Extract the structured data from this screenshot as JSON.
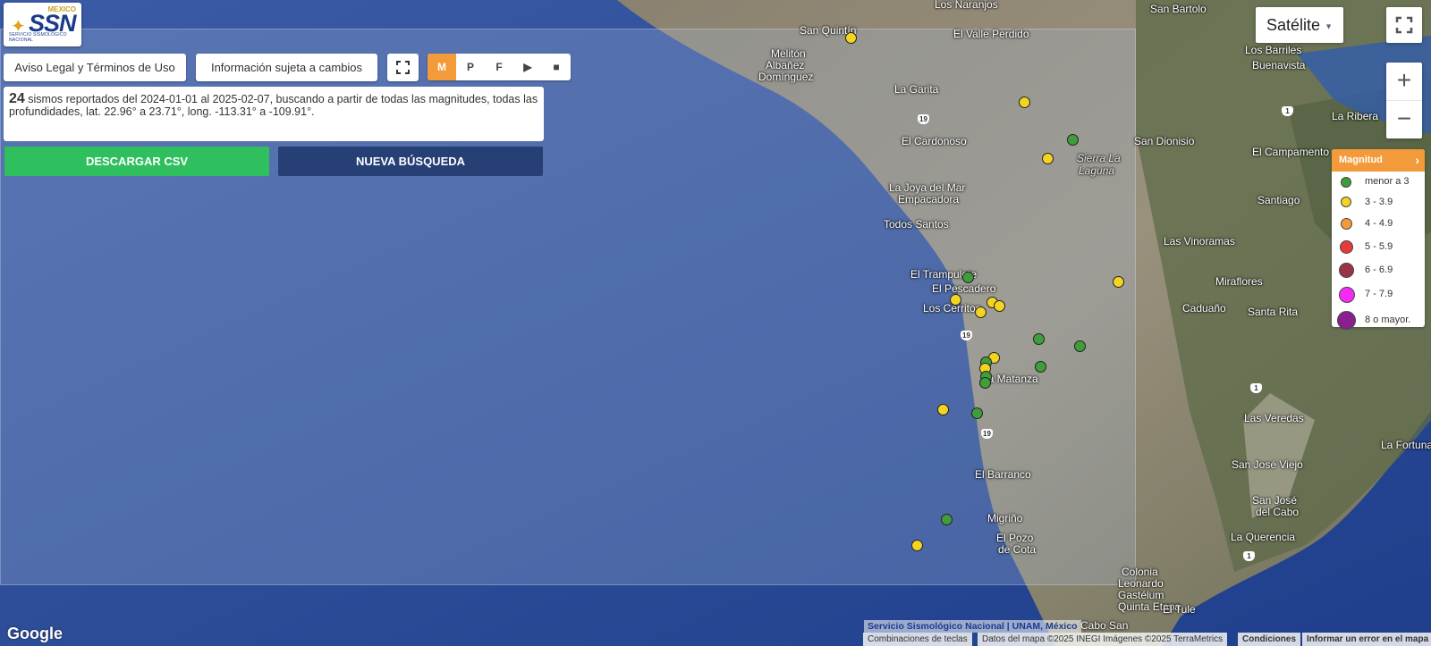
{
  "logo": {
    "top_text": "MEXICO",
    "name": "SSN",
    "subtitle": "SERVICIO SISMOLÓGICO NACIONAL"
  },
  "toolbar": {
    "legal_button": "Aviso Legal y Términos de Uso",
    "info_button": "Información sujeta a cambios",
    "mode_buttons": [
      "M",
      "P",
      "F"
    ]
  },
  "info": {
    "count": "24",
    "text": "sismos reportados del 2024-01-01 al 2025-02-07, buscando a partir de todas las magnitudes, todas las profundidades, lat. 22.96° a 23.71°, long. -113.31° a -109.91°."
  },
  "actions": {
    "download": "DESCARGAR CSV",
    "new_search": "NUEVA BÚSQUEDA"
  },
  "map_controls": {
    "map_type": "Satélite"
  },
  "legend": {
    "title": "Magnitud",
    "items": [
      {
        "label": "menor a 3",
        "color": "#3f9d3a"
      },
      {
        "label": "3 - 3.9",
        "color": "#f2d421"
      },
      {
        "label": "4 - 4.9",
        "color": "#f39a3b"
      },
      {
        "label": "5 - 5.9",
        "color": "#e53a3a"
      },
      {
        "label": "6 - 6.9",
        "color": "#9b3347"
      },
      {
        "label": "7 - 7.9",
        "color": "#f52bf5"
      },
      {
        "label": "8 o mayor.",
        "color": "#8a1f8e"
      }
    ]
  },
  "places": [
    "Los Naranjos",
    "San Bartolo",
    "San Quintín",
    "El Valle Perdido",
    "Melitón",
    "Albañez",
    "Domínguez",
    "Los Barriles",
    "Buenavista",
    "La Garita",
    "La Ribera",
    "El Cardonoso",
    "San Dionisio",
    "El Campamento",
    "Sierra La",
    "Laguna",
    "La Joya del Mar",
    "Empacadora",
    "Santiago",
    "Todos Santos",
    "Las Vinoramas",
    "El Trampulete",
    "El Pescadero",
    "Miraflores",
    "Los Cerritos",
    "Caduaño",
    "Santa Rita",
    "La Matanza",
    "Las Veredas",
    "La Fortuna",
    "El Barranco",
    "San José Viejo",
    "San José",
    "del Cabo",
    "La Querencia",
    "Migriño",
    "El Pozo",
    "de Cota",
    "Colonia",
    "Leonardo",
    "Gastélum",
    "Quinta Etapa",
    "El Tule",
    "Cabo San"
  ],
  "highway_labels": [
    "19",
    "19",
    "1",
    "1",
    "1",
    "19"
  ],
  "attribution": {
    "google": "Google",
    "ssn_credit": "Servicio Sismológico Nacional | UNAM, México",
    "shortcuts": "Combinaciones de teclas",
    "map_data": "Datos del mapa ©2025 INEGI Imágenes ©2025 TerraMetrics",
    "terms": "Condiciones",
    "report": "Informar un error en el mapa"
  }
}
